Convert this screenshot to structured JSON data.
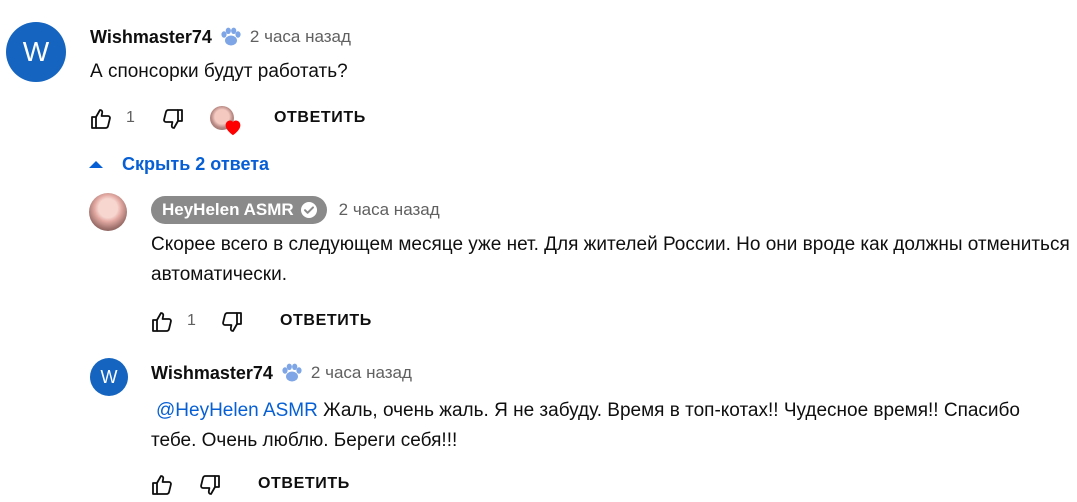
{
  "comment": {
    "avatar_letter": "W",
    "author": "Wishmaster74",
    "time": "2 часа назад",
    "text": "А спонсорки будут работать?",
    "likes": "1",
    "reply_label": "ОТВЕТИТЬ"
  },
  "replies_toggle": {
    "label": "Скрыть 2 ответа"
  },
  "replies": [
    {
      "author": "HeyHelen ASMR",
      "time": "2 часа назад",
      "text": "Скорее всего в следующем месяце уже нет. Для жителей России. Но они вроде как должны отмениться автоматически.",
      "likes": "1",
      "reply_label": "ОТВЕТИТЬ"
    },
    {
      "avatar_letter": "W",
      "author": "Wishmaster74",
      "time": "2 часа назад",
      "mention": "@HeyHelen ASMR",
      "text": "Жаль, очень жаль. Я не забуду. Время в топ-котах!! Чудесное время!! Спасибо тебе. Очень люблю. Береги себя!!!",
      "reply_label": "ОТВЕТИТЬ"
    }
  ],
  "colors": {
    "avatar_blue": "#1565c0",
    "link_blue": "#065fd4",
    "pill_gray": "#8a8a8a",
    "heart_red": "#ff0000",
    "badge_blue": "#5b8fd4"
  }
}
